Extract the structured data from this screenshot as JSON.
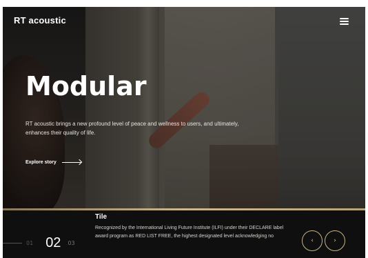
{
  "header": {
    "logo": "RT acoustic",
    "menu_icon": "hamburger-icon"
  },
  "hero": {
    "title": "Modular",
    "description": "RT acoustic brings a new profound level of peace and wellness to users, and ultimately, enhances their quality of life.",
    "cta_label": "Explore story",
    "cta_icon": "arrow-right-icon"
  },
  "slider": {
    "prev_index": "01",
    "current_index": "02",
    "next_index": "03",
    "prev_icon": "chevron-left-icon",
    "next_icon": "chevron-right-icon",
    "prev_glyph": "‹",
    "next_glyph": "›"
  },
  "info": {
    "title": "Tile",
    "body": "Recognized by the International Living Future Institute (ILFI) under their DECLARE label award program as RED LIST FREE, the highest designated level acknowledging no"
  },
  "colors": {
    "accent": "#c8b487",
    "footer_bg": "#0f0f10",
    "text": "#ffffff"
  }
}
